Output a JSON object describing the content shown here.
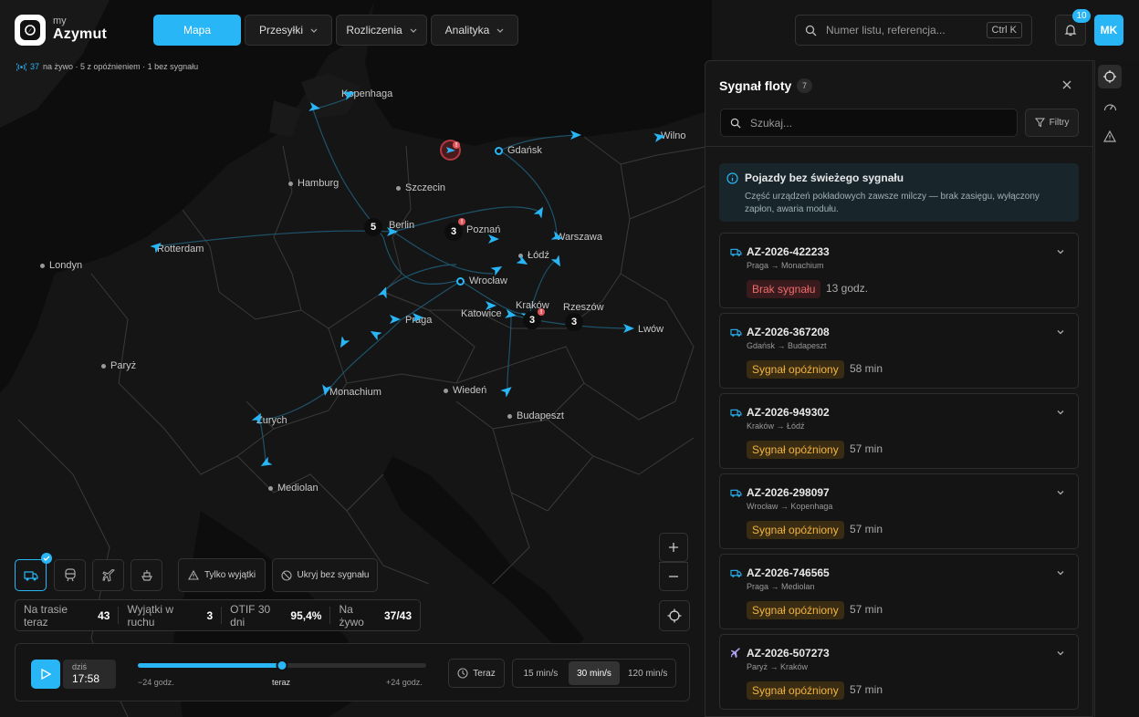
{
  "app": {
    "brand_prefix": "my",
    "brand_name": "Azymut",
    "accent": "#29b6f6"
  },
  "nav": {
    "items": [
      {
        "label": "Mapa",
        "active": true
      },
      {
        "label": "Przesyłki"
      },
      {
        "label": "Rozliczenia"
      },
      {
        "label": "Analityka"
      }
    ]
  },
  "search": {
    "placeholder": "Numer listu, referencja...",
    "shortcut": "Ctrl K"
  },
  "notifications": {
    "count": "10"
  },
  "user": {
    "initials": "MK"
  },
  "live": {
    "count": "37",
    "text": "na żywo · 5 z opóźnieniem · 1 bez sygnału"
  },
  "map": {
    "cities": [
      {
        "name": "Kopenhaga"
      },
      {
        "name": "Gdańsk",
        "hub": true
      },
      {
        "name": "Wilno"
      },
      {
        "name": "Hamburg"
      },
      {
        "name": "Szczecin"
      },
      {
        "name": "Berlin"
      },
      {
        "name": "Poznań"
      },
      {
        "name": "Warszawa"
      },
      {
        "name": "Rotterdam"
      },
      {
        "name": "Londyn"
      },
      {
        "name": "Łódź"
      },
      {
        "name": "Wrocław",
        "hub": true
      },
      {
        "name": "Kraków"
      },
      {
        "name": "Rzeszów"
      },
      {
        "name": "Katowice"
      },
      {
        "name": "Praga"
      },
      {
        "name": "Lwów"
      },
      {
        "name": "Paryż"
      },
      {
        "name": "Monachium"
      },
      {
        "name": "Wiedeń"
      },
      {
        "name": "Budapeszt"
      },
      {
        "name": "Zurych"
      },
      {
        "name": "Mediolan"
      }
    ],
    "clusters": [
      "5",
      "3",
      "3",
      "3"
    ]
  },
  "filters": {
    "only_exceptions": "Tylko wyjątki",
    "hide_no_signal": "Ukryj bez sygnału"
  },
  "stats": [
    {
      "label": "Na trasie teraz",
      "value": "43"
    },
    {
      "label": "Wyjątki w ruchu",
      "value": "3"
    },
    {
      "label": "OTIF 30 dni",
      "value": "95,4%"
    },
    {
      "label": "Na żywo",
      "value": "37/43"
    }
  ],
  "timeline": {
    "day": "dziś",
    "time": "17:58",
    "left": "−24 godz.",
    "mid": "teraz",
    "right": "+24 godz.",
    "progress": 0.5,
    "now_button": "Teraz",
    "speeds": [
      "15 min/s",
      "30 min/s",
      "120 min/s"
    ],
    "active_speed": "30 min/s"
  },
  "panel": {
    "title": "Sygnał floty",
    "count": "7",
    "search_placeholder": "Szukaj...",
    "filter_label": "Filtry",
    "info_title": "Pojazdy bez świeżego sygnału",
    "info_text": "Część urządzeń pokładowych zawsze milczy — brak zasięgu, wyłączony zapłon, awaria modułu.",
    "items": [
      {
        "id": "AZ-2026-422233",
        "route": "Praga → Monachium",
        "status": "Brak sygnału",
        "severity": "red",
        "age": "13 godz.",
        "icon": "truck-icon"
      },
      {
        "id": "AZ-2026-367208",
        "route": "Gdańsk → Budapeszt",
        "status": "Sygnał opóźniony",
        "severity": "yellow",
        "age": "58 min",
        "icon": "truck-icon"
      },
      {
        "id": "AZ-2026-949302",
        "route": "Kraków → Łódź",
        "status": "Sygnał opóźniony",
        "severity": "yellow",
        "age": "57 min",
        "icon": "truck-icon"
      },
      {
        "id": "AZ-2026-298097",
        "route": "Wrocław → Kopenhaga",
        "status": "Sygnał opóźniony",
        "severity": "yellow",
        "age": "57 min",
        "icon": "truck-icon"
      },
      {
        "id": "AZ-2026-746565",
        "route": "Praga → Mediolan",
        "status": "Sygnał opóźniony",
        "severity": "yellow",
        "age": "57 min",
        "icon": "truck-icon"
      },
      {
        "id": "AZ-2026-507273",
        "route": "Paryż → Kraków",
        "status": "Sygnał opóźniony",
        "severity": "yellow",
        "age": "57 min",
        "icon": "plane-icon"
      }
    ]
  }
}
